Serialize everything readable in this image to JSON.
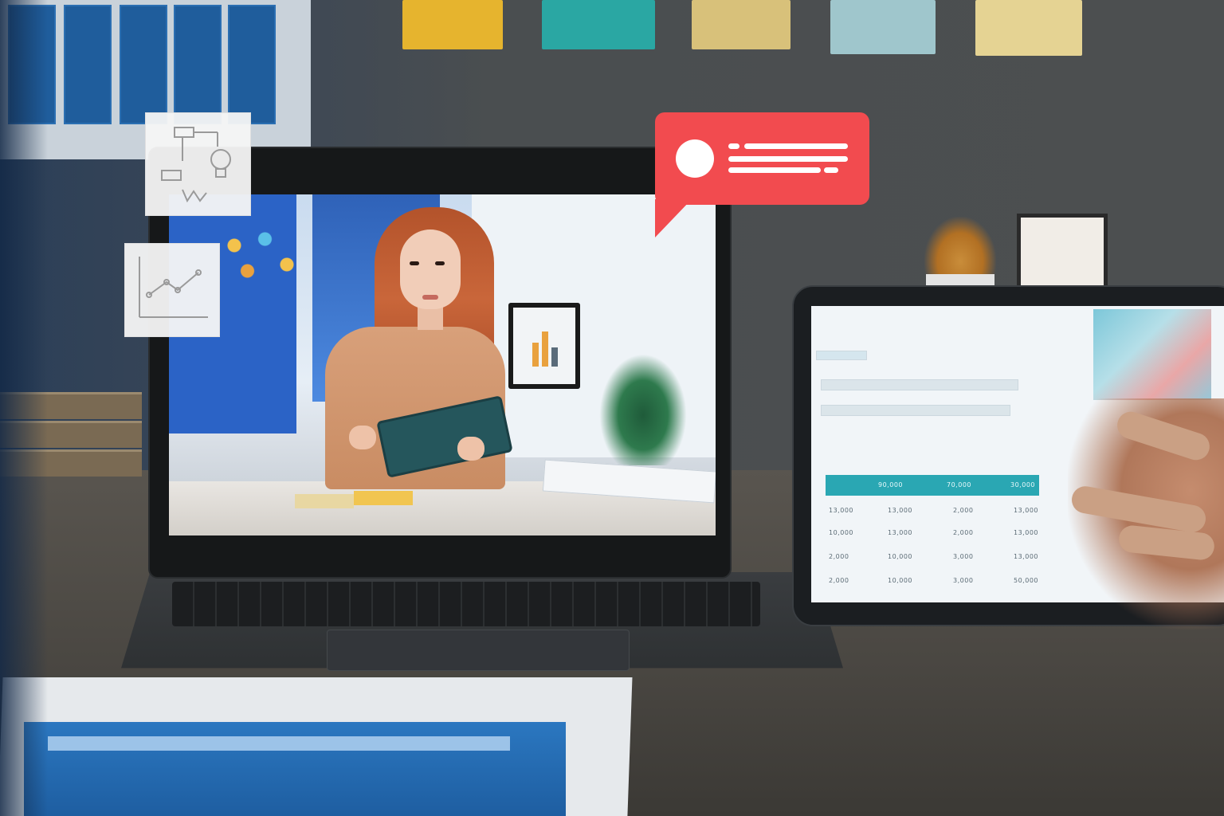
{
  "notification": {
    "color": "#f24b4f",
    "icon": "chat-bubble-icon"
  },
  "floating_cards": {
    "diagram_icon": "idea-diagram-icon",
    "chart_icon": "line-chart-icon"
  },
  "video_call": {
    "participant": "woman-holding-tablet"
  },
  "tablet_table": {
    "headers": [
      "90,000",
      "70,000",
      "30,000"
    ],
    "rows": [
      [
        "13,000",
        "13,000",
        "2,000",
        "13,000"
      ],
      [
        "10,000",
        "13,000",
        "2,000",
        "13,000"
      ],
      [
        "2,000",
        "10,000",
        "3,000",
        "13,000"
      ],
      [
        "2,000",
        "10,000",
        "3,000",
        "50,000"
      ]
    ]
  }
}
